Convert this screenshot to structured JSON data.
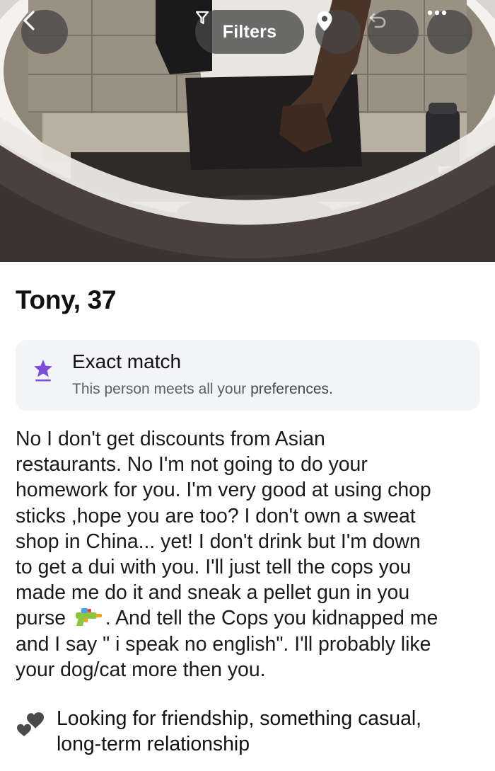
{
  "top_bar": {
    "filters_label": "Filters"
  },
  "profile": {
    "name_age": "Tony, 37"
  },
  "match": {
    "title": "Exact match",
    "subtitle_prefix": "This person meets all your ",
    "subtitle_strong": "preferences.",
    "star_color": "#7b4fd6"
  },
  "bio": {
    "part1": "No I don't get discounts from Asian\nrestaurants. No I'm not going to do your\nhomework for you. I'm very good at using chop\nsticks ,hope you are too? I don't own a sweat\nshop in China... yet! I don't drink but I'm down\nto get a dui with you. I'll just tell the cops you\nmade me do it and sneak a pellet gun in you\npurse ",
    "part2": ". And tell the Cops you kidnapped me\nand I say \" i speak no english\". I'll probably like\nyour dog/cat more then you."
  },
  "looking_for": {
    "text": "Looking for friendship, something casual,\nlong-term relationship"
  }
}
